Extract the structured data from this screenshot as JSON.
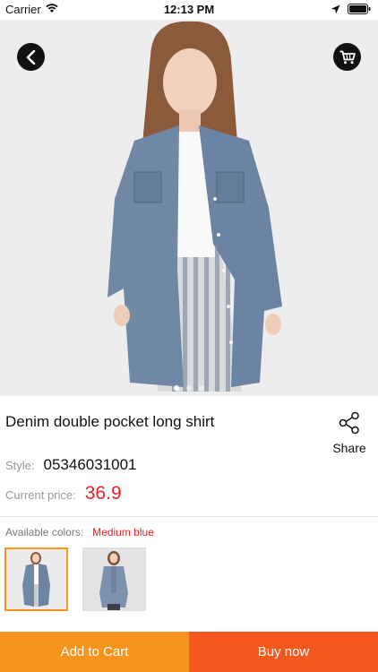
{
  "status_bar": {
    "carrier": "Carrier",
    "time": "12:13 PM"
  },
  "hero": {
    "icons": {
      "back": "chevron-left-icon",
      "cart": "shopping-cart-icon"
    },
    "page_count": 3,
    "current_page": 1
  },
  "product": {
    "title": "Denim double pocket long shirt",
    "share_label": "Share",
    "style_label": "Style:",
    "style_value": "05346031001",
    "price_label": "Current price:",
    "price_value": "36.9",
    "colors_label": "Available colors:",
    "colors_value": "Medium blue"
  },
  "actions": {
    "add_to_cart": "Add to Cart",
    "buy_now": "Buy now"
  },
  "colors": {
    "accent_orange": "#f7941d",
    "accent_red_orange": "#f4581f",
    "price_red": "#e8202a"
  }
}
